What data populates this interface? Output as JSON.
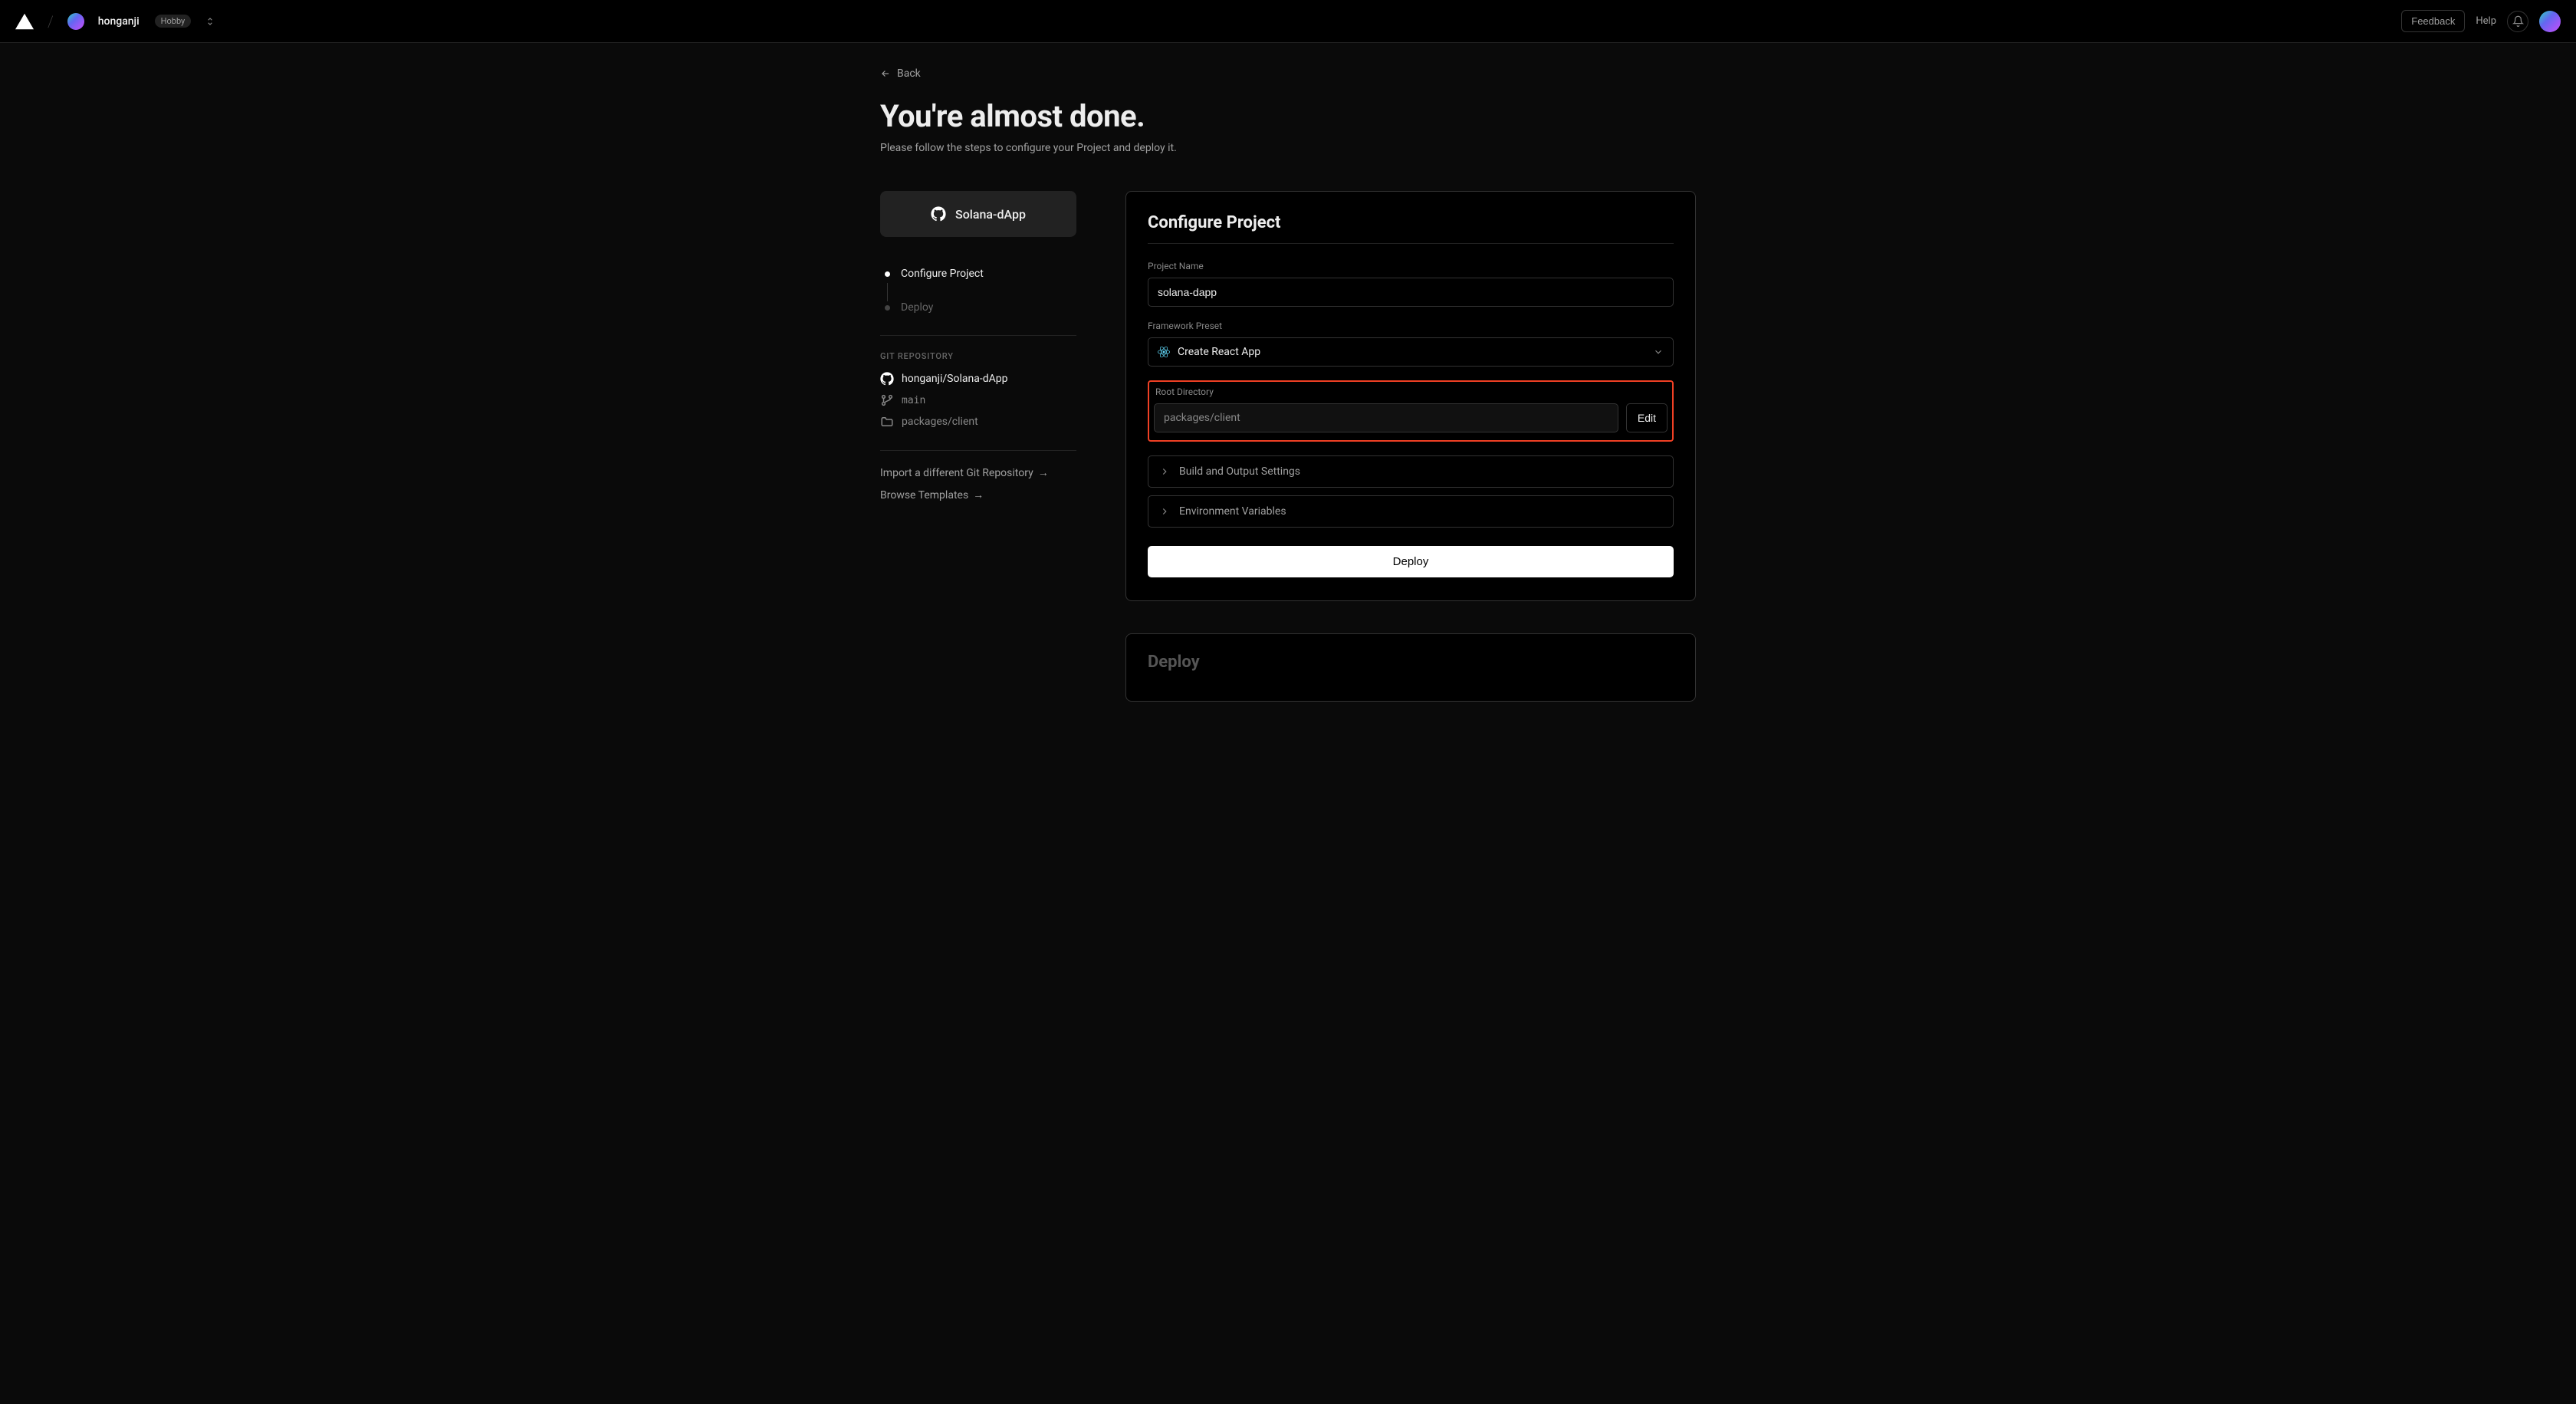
{
  "header": {
    "username": "honganji",
    "plan": "Hobby",
    "feedback": "Feedback",
    "help": "Help"
  },
  "nav": {
    "back": "Back"
  },
  "hero": {
    "title": "You're almost done.",
    "subtitle": "Please follow the steps to configure your Project and deploy it."
  },
  "sidebar": {
    "repo_card_title": "Solana-dApp",
    "steps": {
      "configure": "Configure Project",
      "deploy": "Deploy"
    },
    "git_heading": "GIT REPOSITORY",
    "repo_full": "honganji/Solana-dApp",
    "branch": "main",
    "root_dir": "packages/client",
    "import_link": "Import a different Git Repository",
    "browse_link": "Browse Templates"
  },
  "form": {
    "card_title": "Configure Project",
    "project_name_label": "Project Name",
    "project_name_value": "solana-dapp",
    "framework_label": "Framework Preset",
    "framework_value": "Create React App",
    "root_dir_label": "Root Directory",
    "root_dir_value": "packages/client",
    "edit_label": "Edit",
    "build_accordion": "Build and Output Settings",
    "env_accordion": "Environment Variables",
    "deploy_button": "Deploy"
  },
  "secondary_card": {
    "title": "Deploy"
  }
}
